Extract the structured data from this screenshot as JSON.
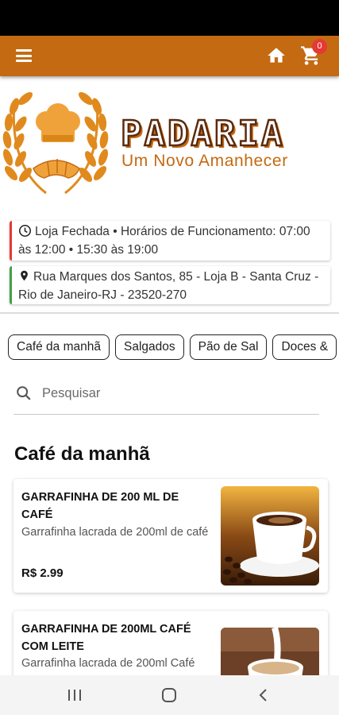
{
  "app_bar": {
    "menu_icon": "hamburger-menu-icon",
    "home_icon": "home-icon",
    "cart_icon": "shopping-cart-icon",
    "cart_count": "0",
    "color": "#c46a12"
  },
  "logo": {
    "title": "PADARIA",
    "subtitle": "Um Novo Amanhecer"
  },
  "store_info": {
    "hours": "Loja Fechada • Horários de Funcionamento: 07:00 às 12:00 • 15:30 às 19:00",
    "address": "Rua Marques dos Santos, 85 - Loja B - Santa Cruz - Rio de Janeiro-RJ - 23520-270"
  },
  "categories": [
    "Café da manhã",
    "Salgados",
    "Pão de Sal",
    "Doces &"
  ],
  "search": {
    "placeholder": "Pesquisar",
    "icon": "search-icon"
  },
  "section": {
    "title": "Café da manhã"
  },
  "products": [
    {
      "name": "GARRAFINHA DE 200 ML DE CAFÉ",
      "description": "Garrafinha lacrada de 200ml de café",
      "price": "R$ 2.99"
    },
    {
      "name": "GARRAFINHA DE 200ML CAFÉ COM LEITE",
      "description": "Garrafinha lacrada de 200ml Café"
    }
  ],
  "nav": {
    "recents_icon": "recents-icon",
    "home_icon": "home-circle-icon",
    "back_icon": "back-chevron-icon"
  }
}
